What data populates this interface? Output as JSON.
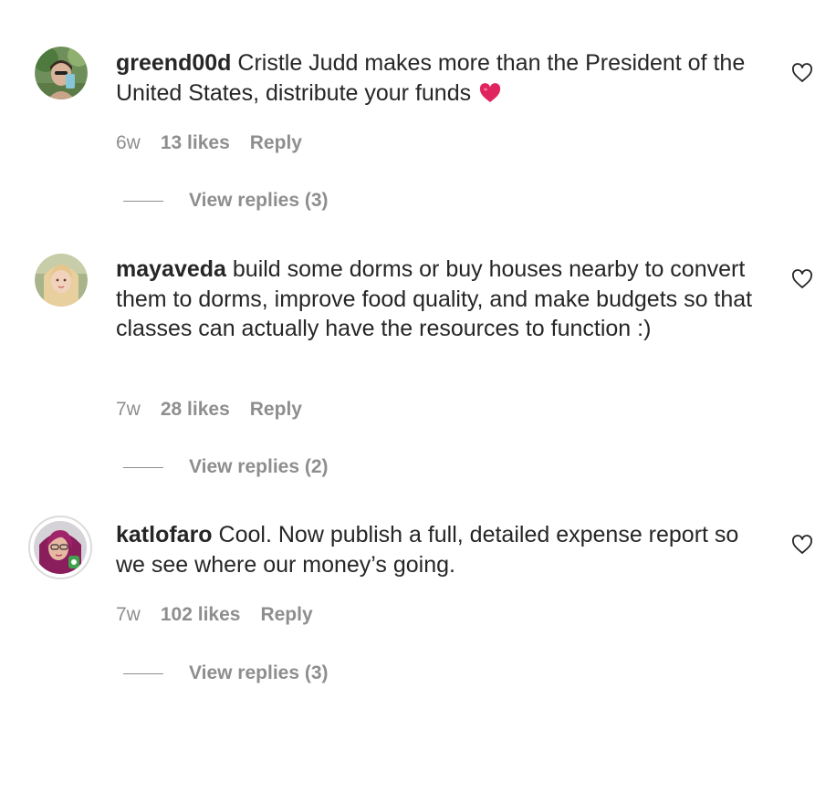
{
  "comments": [
    {
      "username": "greend00d",
      "text": "Cristle Judd makes more than the President of the United States, distribute your funds",
      "emoji": "heart-emoji",
      "time": "6w",
      "likes": "13 likes",
      "reply": "Reply",
      "view_replies": "View replies (3)"
    },
    {
      "username": "mayaveda",
      "text": "build some dorms or buy houses nearby to convert them to dorms, improve food quality, and make budgets so that classes can actually have the resources to function :)",
      "time": "7w",
      "likes": "28 likes",
      "reply": "Reply",
      "view_replies": "View replies (2)"
    },
    {
      "username": "katlofaro",
      "text": "Cool. Now publish a full, detailed expense report so we see where our money’s going.",
      "time": "7w",
      "likes": "102 likes",
      "reply": "Reply",
      "view_replies": "View replies (3)"
    }
  ],
  "colors": {
    "text": "#262626",
    "secondary": "#8e8e8e",
    "emoji_red": "#e0245e",
    "story_ring": "#dbdbdb"
  },
  "icons": {
    "like": "heart-outline-icon"
  }
}
